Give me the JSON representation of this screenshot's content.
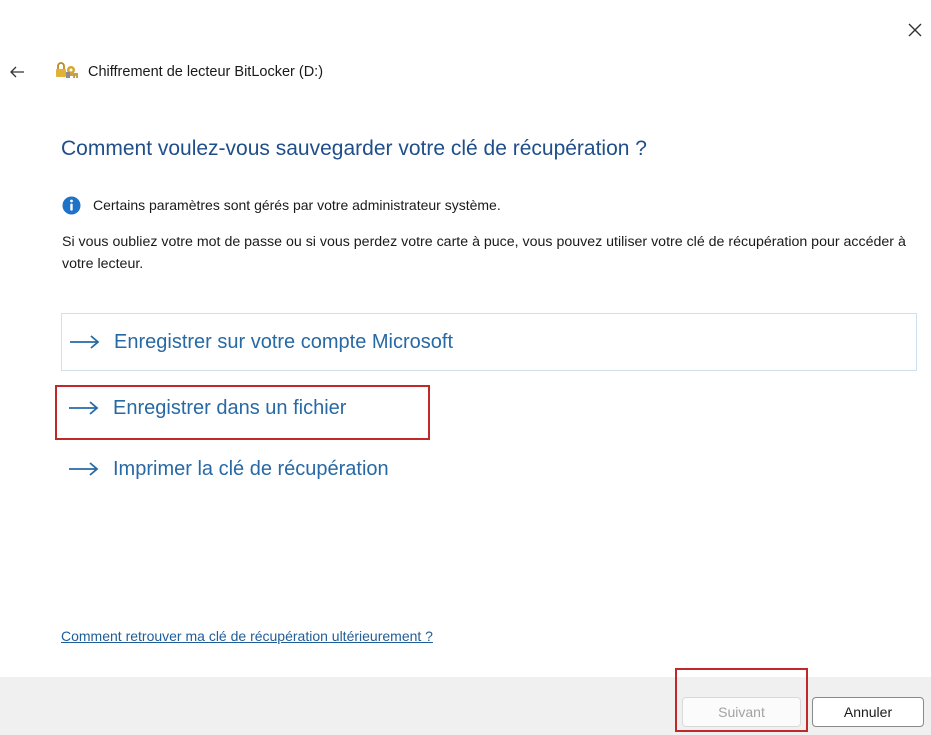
{
  "window": {
    "title": "Chiffrement de lecteur BitLocker (D:)",
    "close_icon": "close-icon",
    "back_icon": "back-arrow-icon",
    "app_icon": "bitlocker-keys-icon"
  },
  "main": {
    "heading": "Comment voulez-vous sauvegarder votre clé de récupération ?",
    "info_notice": "Certains paramètres sont gérés par votre administrateur système.",
    "description": "Si vous oubliez votre mot de passe ou si vous perdez votre carte à puce, vous pouvez utiliser votre clé de récupération pour accéder à votre lecteur."
  },
  "options": [
    {
      "label": "Enregistrer sur votre compte Microsoft",
      "icon": "arrow-right-icon"
    },
    {
      "label": "Enregistrer dans un fichier",
      "icon": "arrow-right-icon"
    },
    {
      "label": "Imprimer la clé de récupération",
      "icon": "arrow-right-icon"
    }
  ],
  "help_link": "Comment retrouver ma clé de récupération ultérieurement ?",
  "footer": {
    "next_label": "Suivant",
    "next_enabled": false,
    "cancel_label": "Annuler"
  },
  "colors": {
    "heading": "#1f4e8a",
    "link": "#2769a5",
    "annotation": "#c0282a",
    "info_icon": "#1e73c9"
  }
}
